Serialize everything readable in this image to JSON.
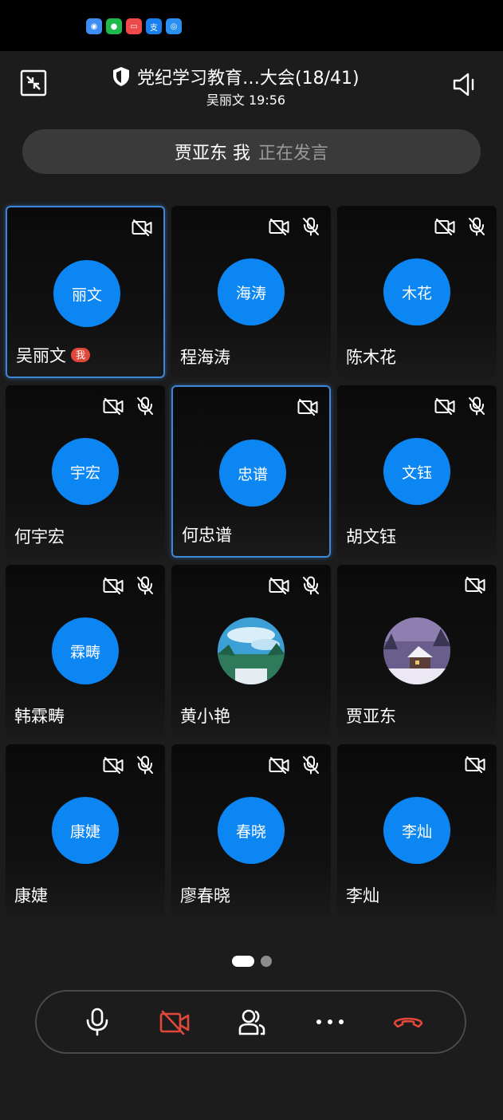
{
  "status_bar": {
    "app_icons": [
      {
        "name": "weibo-app-icon",
        "color": "#3d8df2",
        "glyph": "◉"
      },
      {
        "name": "wechat-app-icon",
        "color": "#1fb84b",
        "glyph": "●"
      },
      {
        "name": "dianping-app-icon",
        "color": "#ef4a4a",
        "glyph": "▭"
      },
      {
        "name": "alipay-app-icon",
        "color": "#1a7ff0",
        "glyph": "支"
      },
      {
        "name": "browser-app-icon",
        "color": "#2a8ff0",
        "glyph": "◎"
      }
    ]
  },
  "header": {
    "title": "党纪学习教育…大会(18/41)",
    "host_time": "吴丽文 19:56"
  },
  "speaker": {
    "name": "贾亚东 我",
    "status": "正在发言"
  },
  "participants": [
    {
      "name": "吴丽文",
      "avatar": "丽文",
      "video_off": true,
      "muted": false,
      "is_me": true,
      "me_label": "我",
      "active": true,
      "photo": null
    },
    {
      "name": "程海涛",
      "avatar": "海涛",
      "video_off": true,
      "muted": true,
      "is_me": false,
      "active": false,
      "photo": null
    },
    {
      "name": "陈木花",
      "avatar": "木花",
      "video_off": true,
      "muted": true,
      "is_me": false,
      "active": false,
      "photo": null
    },
    {
      "name": "何宇宏",
      "avatar": "宇宏",
      "video_off": true,
      "muted": true,
      "is_me": false,
      "active": false,
      "photo": null
    },
    {
      "name": "何忠谱",
      "avatar": "忠谱",
      "video_off": true,
      "muted": false,
      "is_me": false,
      "active": true,
      "photo": null
    },
    {
      "name": "胡文钰",
      "avatar": "文钰",
      "video_off": true,
      "muted": true,
      "is_me": false,
      "active": false,
      "photo": null
    },
    {
      "name": "韩霖畴",
      "avatar": "霖畴",
      "video_off": true,
      "muted": true,
      "is_me": false,
      "active": false,
      "photo": null
    },
    {
      "name": "黄小艳",
      "avatar": "",
      "video_off": true,
      "muted": true,
      "is_me": false,
      "active": false,
      "photo": "sky-trees"
    },
    {
      "name": "贾亚东",
      "avatar": "",
      "video_off": true,
      "muted": false,
      "is_me": false,
      "active": false,
      "photo": "snow-cabin"
    },
    {
      "name": "康婕",
      "avatar": "康婕",
      "video_off": true,
      "muted": true,
      "is_me": false,
      "active": false,
      "photo": null
    },
    {
      "name": "廖春晓",
      "avatar": "春晓",
      "video_off": true,
      "muted": true,
      "is_me": false,
      "active": false,
      "photo": null
    },
    {
      "name": "李灿",
      "avatar": "李灿",
      "video_off": true,
      "muted": false,
      "is_me": false,
      "active": false,
      "photo": null
    }
  ],
  "pager": {
    "pages": 2,
    "current": 1
  },
  "toolbar": {
    "buttons": [
      "microphone-icon",
      "camera-off-icon",
      "participants-icon",
      "more-icon",
      "hang-up-icon"
    ]
  },
  "colors": {
    "background": "#1c1c1c",
    "avatar": "#0c86f2",
    "accent_border": "#3c87d8",
    "danger": "#e1483a",
    "me_badge": "#e1483a"
  }
}
